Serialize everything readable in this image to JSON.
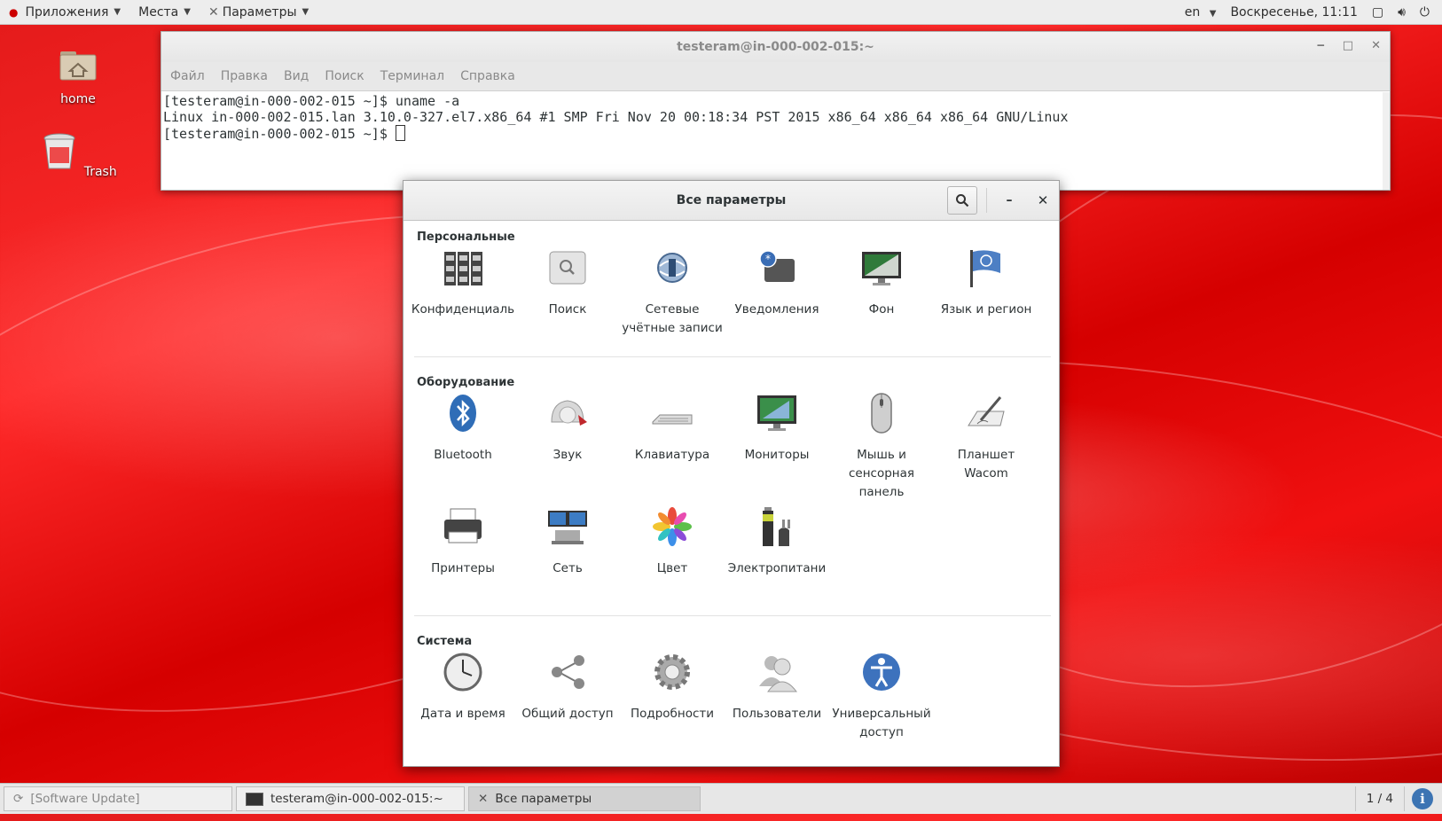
{
  "topbar": {
    "apps": "Приложения",
    "places": "Места",
    "current_app": "Параметры",
    "lang": "en",
    "clock": "Воскресенье, 11:11"
  },
  "desktop": {
    "icons": [
      {
        "label": "home",
        "icon": "home-folder-icon"
      },
      {
        "label": "Trash",
        "icon": "trash-icon"
      }
    ]
  },
  "terminal": {
    "title": "testeram@in-000-002-015:~",
    "menu": [
      "Файл",
      "Правка",
      "Вид",
      "Поиск",
      "Терминал",
      "Справка"
    ],
    "lines": [
      "[testeram@in-000-002-015 ~]$ uname -a",
      "Linux in-000-002-015.lan 3.10.0-327.el7.x86_64 #1 SMP Fri Nov 20 00:18:34 PST 2015 x86_64 x86_64 x86_64 GNU/Linux",
      "[testeram@in-000-002-015 ~]$ "
    ]
  },
  "settings": {
    "title": "Все параметры",
    "sections": [
      {
        "title": "Персональные",
        "items": [
          {
            "label": "Конфиденциаль",
            "icon": "privacy-icon"
          },
          {
            "label": "Поиск",
            "icon": "search-settings-icon"
          },
          {
            "label": "Сетевые учётные записи",
            "icon": "online-accounts-icon"
          },
          {
            "label": "Уведомления",
            "icon": "notifications-icon"
          },
          {
            "label": "Фон",
            "icon": "background-icon"
          },
          {
            "label": "Язык и регион",
            "icon": "region-flag-icon"
          }
        ]
      },
      {
        "title": "Оборудование",
        "items": [
          {
            "label": "Bluetooth",
            "icon": "bluetooth-icon"
          },
          {
            "label": "Звук",
            "icon": "sound-icon"
          },
          {
            "label": "Клавиатура",
            "icon": "keyboard-icon"
          },
          {
            "label": "Мониторы",
            "icon": "monitors-icon"
          },
          {
            "label": "Мышь и сенсорная панель",
            "icon": "mouse-icon"
          },
          {
            "label": "Планшет Wacom",
            "icon": "wacom-tablet-icon"
          },
          {
            "label": "Принтеры",
            "icon": "printer-icon"
          },
          {
            "label": "Сеть",
            "icon": "network-icon"
          },
          {
            "label": "Цвет",
            "icon": "color-icon"
          },
          {
            "label": "Электропитани",
            "icon": "power-icon"
          }
        ]
      },
      {
        "title": "Система",
        "items": [
          {
            "label": "Дата и время",
            "icon": "clock-icon"
          },
          {
            "label": "Общий доступ",
            "icon": "sharing-icon"
          },
          {
            "label": "Подробности",
            "icon": "details-gear-icon"
          },
          {
            "label": "Пользователи",
            "icon": "users-icon"
          },
          {
            "label": "Универсальный доступ",
            "icon": "accessibility-icon"
          }
        ]
      }
    ]
  },
  "taskbar": {
    "tasks": [
      {
        "label": "[Software Update]",
        "icon": "software-update-icon"
      },
      {
        "label": "testeram@in-000-002-015:~",
        "icon": "terminal-icon"
      },
      {
        "label": "Все параметры",
        "icon": "settings-icon"
      }
    ],
    "pager": "1 / 4"
  }
}
